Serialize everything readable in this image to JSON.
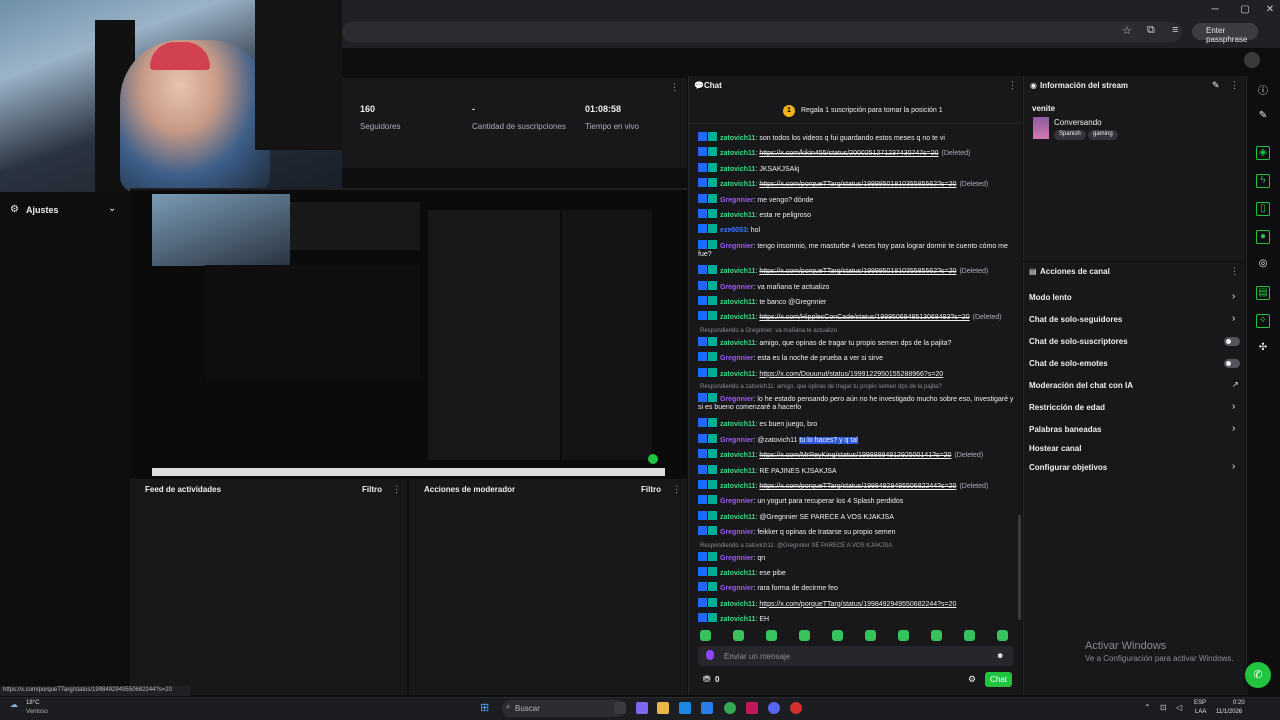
{
  "browser": {
    "passphrase_label": "Enter passphrase",
    "status_url": "https://x.com/porqueTTarg/status/1998492949550682244?s=20"
  },
  "stats": [
    {
      "value": "160",
      "label": "Seguidores"
    },
    {
      "value": "-",
      "label": "Cantidad de suscripciones"
    },
    {
      "value": "01:08:58",
      "label": "Tiempo en vivo"
    }
  ],
  "left": {
    "settings_label": "Ajustes"
  },
  "activity_feed": {
    "title": "Feed de actividades",
    "filter_label": "Filtro"
  },
  "mod_actions": {
    "title": "Acciones de moderador",
    "filter_label": "Filtro"
  },
  "chat": {
    "title": "Chat",
    "gift_prompt": "Regala 1 suscripción para tomar la posición 1",
    "input_placeholder": "Enviar un mensaje",
    "send_label": "Chat",
    "points": "0",
    "messages": [
      {
        "user": "zatovich11",
        "color": "green",
        "text": "son todos los videos q fui guardando estos meses q no te vi",
        "type": "text"
      },
      {
        "user": "zatovich11",
        "color": "green",
        "text": "https://x.com/kikin455/status/2000251271237430747s=20",
        "type": "deleted",
        "deleted_label": "(Deleted)"
      },
      {
        "user": "zatovich11",
        "color": "green",
        "text": "JKSAKJSAkj",
        "type": "text"
      },
      {
        "user": "zatovich11",
        "color": "green",
        "text": "https://x.com/porqueTTarg/status/1999950181035585562?s=20",
        "type": "deleted",
        "deleted_label": "(Deleted)"
      },
      {
        "user": "Gregnnier",
        "color": "purple",
        "text": "me vengo? dónde",
        "type": "text"
      },
      {
        "user": "zatovich11",
        "color": "green",
        "text": "esta re peligroso",
        "type": "text"
      },
      {
        "user": "eze0053",
        "color": "blue",
        "text": "hol",
        "type": "text"
      },
      {
        "user": "Gregnnier",
        "color": "purple",
        "text": "tengo insomnio, me masturbe 4 veces hoy para lograr dormir te cuento cómo me",
        "text2": "fue?",
        "type": "text"
      },
      {
        "user": "zatovich11",
        "color": "green",
        "text": "https://x.com/porqueTTarg/status/1999950181035585562?s=20",
        "type": "deleted",
        "deleted_label": "(Deleted)"
      },
      {
        "user": "Gregnnier",
        "color": "purple",
        "text": "va mañana te actualizo",
        "type": "text"
      },
      {
        "user": "zatovich11",
        "color": "green",
        "text": "te banco @Gregnnier",
        "type": "text"
      },
      {
        "user": "zatovich11",
        "color": "green",
        "text": "https://x.com/HipplesConCade/status/1999506948513068493?s=20",
        "type": "deleted",
        "deleted_label": "(Deleted)"
      },
      {
        "reply": "Respondiendo a Gregnnier: va mañana te actualizo"
      },
      {
        "user": "zatovich11",
        "color": "green",
        "text": "amigo, que opinas de tragar tu propio semen dps de la pajita?",
        "type": "text"
      },
      {
        "user": "Gregnnier",
        "color": "purple",
        "text": "esta es la noche de prueba a ver si sirve",
        "type": "text"
      },
      {
        "user": "zatovich11",
        "color": "green",
        "text": "https://x.com/Douunut/status/1999122950155288966?s=20",
        "type": "link"
      },
      {
        "reply": "Respondiendo a zatovich11: amigo, que opinas de tragar tu propio semen dps de la pajita?"
      },
      {
        "user": "Gregnnier",
        "color": "purple",
        "text": "lo he estado pensando pero aún no he investigado mucho sobre eso, investigaré y",
        "text2": "si es bueno comenzaré a hacerlo",
        "type": "text"
      },
      {
        "user": "zatovich11",
        "color": "green",
        "text": "es buen juego, bro",
        "type": "text"
      },
      {
        "user": "Gregnnier",
        "color": "purple",
        "text": "@zatovich11",
        "highlight": "tu lo haces? y q tal",
        "type": "highlight"
      },
      {
        "user": "zatovich11",
        "color": "green",
        "text": "https://x.com/MrReyKing/status/1998888491292500141?s=20",
        "type": "deleted",
        "deleted_label": "(Deleted)"
      },
      {
        "user": "zatovich11",
        "color": "green",
        "text": "RE PAJINES KJSAKJSA",
        "type": "text"
      },
      {
        "user": "zatovich11",
        "color": "green",
        "text": "https://x.com/porqueTTarg/status/1998492949550682244?s=20",
        "type": "deleted",
        "deleted_label": "(Deleted)"
      },
      {
        "user": "Gregnnier",
        "color": "purple",
        "text": "un yogurt para recuperar los 4 Splash perdidos",
        "type": "text"
      },
      {
        "user": "zatovich11",
        "color": "green",
        "text": "@Gregnnier SE PARECE A VOS KJAKJSA",
        "type": "text"
      },
      {
        "user": "Gregnnier",
        "color": "purple",
        "text": "feikker q opinas de tratarse su propio semen",
        "type": "text"
      },
      {
        "reply": "Respondiendo a zatovich11: @Gregnnier SE PARECE A VOS KJAKJSA"
      },
      {
        "user": "Gregnnier",
        "color": "purple",
        "text": "qn",
        "type": "text"
      },
      {
        "user": "zatovich11",
        "color": "green",
        "text": "ese pibe",
        "type": "text"
      },
      {
        "user": "Gregnnier",
        "color": "purple",
        "text": "rara forma de decirme feo",
        "type": "text"
      },
      {
        "user": "zatovich11",
        "color": "green",
        "text": "https://x.com/porqueTTarg/status/1998492949550682244?s=20",
        "type": "link"
      },
      {
        "user": "zatovich11",
        "color": "green",
        "text": "EH",
        "type": "text"
      }
    ]
  },
  "stream_info": {
    "title": "Información del stream",
    "channel": "venite",
    "category": "Conversando",
    "tags": [
      "Spanish",
      "gaming"
    ]
  },
  "channel_actions": {
    "title": "Acciones de canal",
    "items": [
      {
        "label": "Modo lento",
        "control": "chevron"
      },
      {
        "label": "Chat de solo-seguidores",
        "control": "chevron"
      },
      {
        "label": "Chat de solo-suscriptores",
        "control": "toggle"
      },
      {
        "label": "Chat de solo-emotes",
        "control": "toggle"
      },
      {
        "label": "Moderación del chat con IA",
        "control": "external"
      },
      {
        "label": "Restricción de edad",
        "control": "chevron"
      },
      {
        "label": "Palabras baneadas",
        "control": "chevron"
      },
      {
        "label": "Hostear canal",
        "control": "none"
      },
      {
        "label": "Configurar objetivos",
        "control": "chevron"
      }
    ]
  },
  "windows": {
    "activate_title": "Activar Windows",
    "activate_sub": "Ve a Configuración para activar Windows."
  },
  "taskbar": {
    "weather_temp": "18°C",
    "weather_desc": "Ventoso",
    "search_label": "Buscar",
    "lang_top": "ESP",
    "lang_bottom": "LAA",
    "time": "0:20",
    "date": "11/1/2026"
  }
}
